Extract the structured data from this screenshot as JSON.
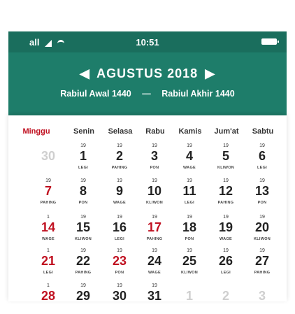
{
  "status": {
    "time": "10:51",
    "carrier": "all"
  },
  "header": {
    "month": "AGUSTUS 2018",
    "hijri_start": "Rabiul Awal 1440",
    "dash": "—",
    "hijri_end": "Rabiul Akhir 1440",
    "prev_icon": "◀",
    "next_icon": "▶"
  },
  "weekdays": [
    "Minggu",
    "Senin",
    "Selasa",
    "Rabu",
    "Kamis",
    "Jum'at",
    "Sabtu"
  ],
  "colors": {
    "header": "#1e7d6a",
    "sunday": "#c01020"
  },
  "weeks": [
    [
      {
        "day": "30",
        "faded": true
      },
      {
        "day": "1",
        "hij": "19",
        "pas": "LEGI"
      },
      {
        "day": "2",
        "hij": "19",
        "pas": "PAHING"
      },
      {
        "day": "3",
        "hij": "19",
        "pas": "PON"
      },
      {
        "day": "4",
        "hij": "19",
        "pas": "WAGE"
      },
      {
        "day": "5",
        "hij": "19",
        "pas": "KLIWON"
      },
      {
        "day": "6",
        "hij": "19",
        "pas": "LEGI"
      }
    ],
    [
      {
        "day": "7",
        "red": true,
        "hij": "19",
        "pas": "PAHING"
      },
      {
        "day": "8",
        "hij": "19",
        "pas": "PON"
      },
      {
        "day": "9",
        "hij": "19",
        "pas": "WAGE"
      },
      {
        "day": "10",
        "hij": "19",
        "pas": "KLIWON"
      },
      {
        "day": "11",
        "hij": "19",
        "pas": "LEGI"
      },
      {
        "day": "12",
        "hij": "19",
        "pas": "PAHING"
      },
      {
        "day": "13",
        "hij": "19",
        "pas": "PON"
      }
    ],
    [
      {
        "day": "14",
        "red": true,
        "hij": "1",
        "pas": "WAGE"
      },
      {
        "day": "15",
        "hij": "19",
        "pas": "KLIWON"
      },
      {
        "day": "16",
        "hij": "19",
        "pas": "LEGI"
      },
      {
        "day": "17",
        "red": true,
        "hij": "19",
        "pas": "PAHING"
      },
      {
        "day": "18",
        "hij": "19",
        "pas": "PON"
      },
      {
        "day": "19",
        "hij": "19",
        "pas": "WAGE"
      },
      {
        "day": "20",
        "hij": "19",
        "pas": "KLIWON"
      }
    ],
    [
      {
        "day": "21",
        "red": true,
        "hij": "1",
        "pas": "LEGI"
      },
      {
        "day": "22",
        "hij": "19",
        "pas": "PAHING"
      },
      {
        "day": "23",
        "red": true,
        "hij": "19",
        "pas": "PON"
      },
      {
        "day": "24",
        "hij": "19",
        "pas": "WAGE"
      },
      {
        "day": "25",
        "hij": "19",
        "pas": "KLIWON"
      },
      {
        "day": "26",
        "hij": "19",
        "pas": "LEGI"
      },
      {
        "day": "27",
        "hij": "19",
        "pas": "PAHING"
      }
    ],
    [
      {
        "day": "28",
        "red": true,
        "hij": "1"
      },
      {
        "day": "29",
        "hij": "19"
      },
      {
        "day": "30",
        "hij": "19"
      },
      {
        "day": "31",
        "hij": "19"
      },
      {
        "day": "1",
        "faded": true
      },
      {
        "day": "2",
        "faded": true
      },
      {
        "day": "3",
        "faded": true
      }
    ]
  ]
}
